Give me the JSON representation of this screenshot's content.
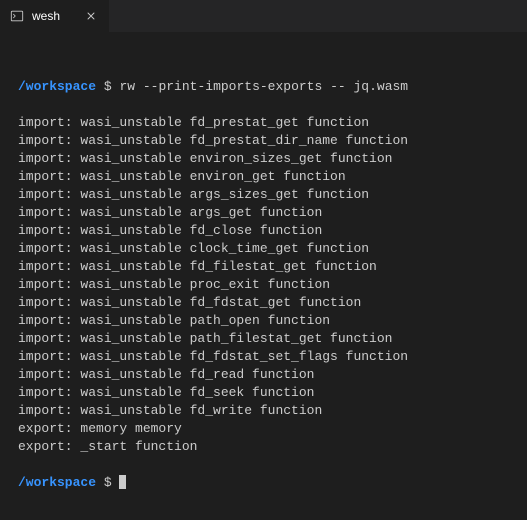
{
  "tab": {
    "label": "wesh"
  },
  "prompt": {
    "path": "/workspace",
    "symbol": "$"
  },
  "command": "rw --print-imports-exports -- jq.wasm",
  "output": [
    "import: wasi_unstable fd_prestat_get function",
    "import: wasi_unstable fd_prestat_dir_name function",
    "import: wasi_unstable environ_sizes_get function",
    "import: wasi_unstable environ_get function",
    "import: wasi_unstable args_sizes_get function",
    "import: wasi_unstable args_get function",
    "import: wasi_unstable fd_close function",
    "import: wasi_unstable clock_time_get function",
    "import: wasi_unstable fd_filestat_get function",
    "import: wasi_unstable proc_exit function",
    "import: wasi_unstable fd_fdstat_get function",
    "import: wasi_unstable path_open function",
    "import: wasi_unstable path_filestat_get function",
    "import: wasi_unstable fd_fdstat_set_flags function",
    "import: wasi_unstable fd_read function",
    "import: wasi_unstable fd_seek function",
    "import: wasi_unstable fd_write function",
    "export: memory memory",
    "export: _start function"
  ]
}
